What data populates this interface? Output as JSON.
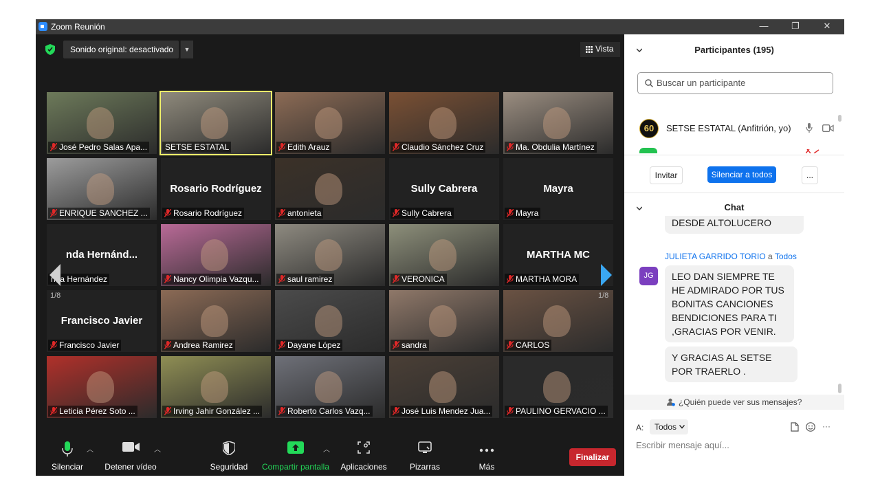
{
  "window": {
    "title": "Zoom Reunión",
    "minimize": "—",
    "maximize": "❐",
    "close": "✕"
  },
  "meeting": {
    "audio_label": "Sonido original: desactivado",
    "view_label": "Vista",
    "page_left": "1/8",
    "page_right": "1/8"
  },
  "tiles": [
    {
      "name": "José Pedro Salas Apa...",
      "video": true,
      "muted": true,
      "color": "#6d7a5a"
    },
    {
      "name": "SETSE ESTATAL",
      "video": true,
      "muted": false,
      "color": "#8f8a7c",
      "active": true
    },
    {
      "name": "Edith Arauz",
      "video": true,
      "muted": true,
      "color": "#8c6b55"
    },
    {
      "name": "Claudio Sánchez Cruz",
      "video": true,
      "muted": true,
      "color": "#7a5034"
    },
    {
      "name": "Ma. Obdulia Martínez",
      "video": true,
      "muted": true,
      "color": "#9a8d80"
    },
    {
      "name": "ENRIQUE SANCHEZ ...",
      "video": true,
      "muted": true,
      "color": "#9c9c9c"
    },
    {
      "name": "Rosario Rodríguez",
      "video": false,
      "muted": true,
      "big": "Rosario Rodríguez"
    },
    {
      "name": "antonieta",
      "video": true,
      "muted": true,
      "color": "#3b3128"
    },
    {
      "name": "Sully Cabrera",
      "video": false,
      "muted": true,
      "big": "Sully Cabrera"
    },
    {
      "name": "Mayra",
      "video": false,
      "muted": true,
      "big": "Mayra"
    },
    {
      "name": "nda Hernández",
      "video": false,
      "muted": false,
      "big": "nda  Hernánd..."
    },
    {
      "name": "Nancy Olimpia Vazqu...",
      "video": true,
      "muted": true,
      "color": "#b96a97"
    },
    {
      "name": "saul ramirez",
      "video": true,
      "muted": true,
      "color": "#8e8a80"
    },
    {
      "name": "VERONICA",
      "video": true,
      "muted": true,
      "color": "#8d8f7a"
    },
    {
      "name": "MARTHA  MORA",
      "video": false,
      "muted": true,
      "big": "MARTHA  MC"
    },
    {
      "name": "Francisco Javier",
      "video": false,
      "muted": true,
      "big": "Francisco Javier"
    },
    {
      "name": "Andrea Ramirez",
      "video": true,
      "muted": true,
      "color": "#8b6a55"
    },
    {
      "name": "Dayane López",
      "video": true,
      "muted": true,
      "color": "#4b4b4b"
    },
    {
      "name": "sandra",
      "video": true,
      "muted": true,
      "color": "#8f7869"
    },
    {
      "name": "CARLOS",
      "video": true,
      "muted": true,
      "color": "#6a5243"
    },
    {
      "name": "Leticia Pérez Soto ...",
      "video": true,
      "muted": true,
      "color": "#b0302a"
    },
    {
      "name": "Irving Jahir González ...",
      "video": true,
      "muted": true,
      "color": "#8f8e54"
    },
    {
      "name": "Roberto Carlos Vazq...",
      "video": true,
      "muted": true,
      "color": "#6e7078"
    },
    {
      "name": "José Luis Mendez Jua...",
      "video": true,
      "muted": true,
      "color": "#4a3f36"
    },
    {
      "name": "PAULINO GERVACIO ...",
      "video": true,
      "muted": true,
      "color": "#2a2a2a"
    }
  ],
  "toolbar": {
    "mute": "Silenciar",
    "video": "Detener vídeo",
    "security": "Seguridad",
    "share": "Compartir pantalla",
    "apps": "Aplicaciones",
    "whiteboards": "Pizarras",
    "more": "Más",
    "end": "Finalizar"
  },
  "participants": {
    "header": "Participantes (195)",
    "search_placeholder": "Buscar un participante",
    "host_name": "SETSE ESTATAL (Anfitrión, yo)",
    "invite": "Invitar",
    "mute_all": "Silenciar a todos",
    "more": "..."
  },
  "chat": {
    "header": "Chat",
    "prev_message": "DESDE ALTOLUCERO",
    "sender": "JULIETA GARRIDO TORIO",
    "to_word": "a",
    "recipient": "Todos",
    "avatar_initials": "JG",
    "message1": "LEO DAN SIEMPRE TE HE ADMIRADO POR TUS BONITAS CANCIONES BENDICIONES PARA TI ,GRACIAS POR VENIR.",
    "message2": "Y GRACIAS AL  SETSE POR TRAERLO .",
    "who_can_see": "¿Quién puede ver sus mensajes?",
    "to_label": "A:",
    "to_select": "Todos",
    "input_placeholder": "Escribir mensaje aquí...",
    "more": "···"
  },
  "colors": {
    "accent": "#0e72ed",
    "end": "#c7272e",
    "share": "#23d959",
    "mic": "#23d959",
    "mute_red": "#e02828"
  }
}
